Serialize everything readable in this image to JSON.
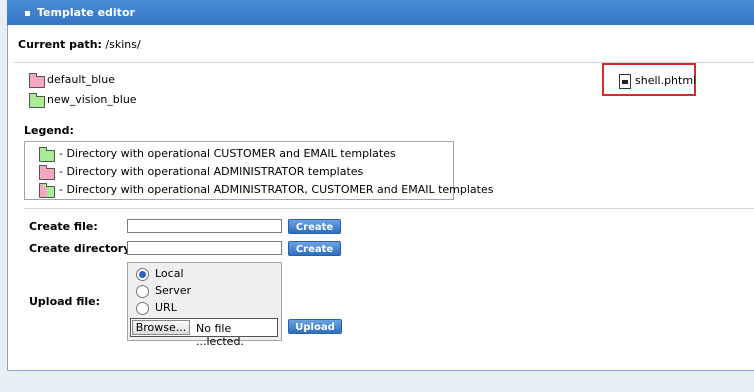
{
  "window": {
    "title": "Template editor"
  },
  "path": {
    "label": "Current path:",
    "value": "/skins/"
  },
  "directories": [
    {
      "name": "default_blue",
      "color": "pink"
    },
    {
      "name": "new_vision_blue",
      "color": "green"
    }
  ],
  "files": [
    {
      "name": "shell.phtml",
      "highlighted": true
    }
  ],
  "legend": {
    "title": "Legend:",
    "items": [
      {
        "text": "- Directory with operational CUSTOMER and EMAIL templates",
        "color": "green"
      },
      {
        "text": "- Directory with operational ADMINISTRATOR templates",
        "color": "pink"
      },
      {
        "text": "- Directory with operational ADMINISTRATOR, CUSTOMER and EMAIL templates",
        "color": "mixed"
      }
    ]
  },
  "create_file": {
    "label": "Create file:",
    "value": "",
    "button": "Create"
  },
  "create_directory": {
    "label": "Create directory:",
    "value": "",
    "button": "Create"
  },
  "upload": {
    "label": "Upload file:",
    "options": [
      "Local",
      "Server",
      "URL"
    ],
    "selected": "Local",
    "browse_label": "Browse...",
    "file_status": "No file ...lected.",
    "button": "Upload"
  },
  "colors": {
    "titlebar": "#3f82d1",
    "highlight_border": "#d32c2c",
    "folder_pink": "#f7a6c3",
    "folder_green": "#a9ec98"
  }
}
